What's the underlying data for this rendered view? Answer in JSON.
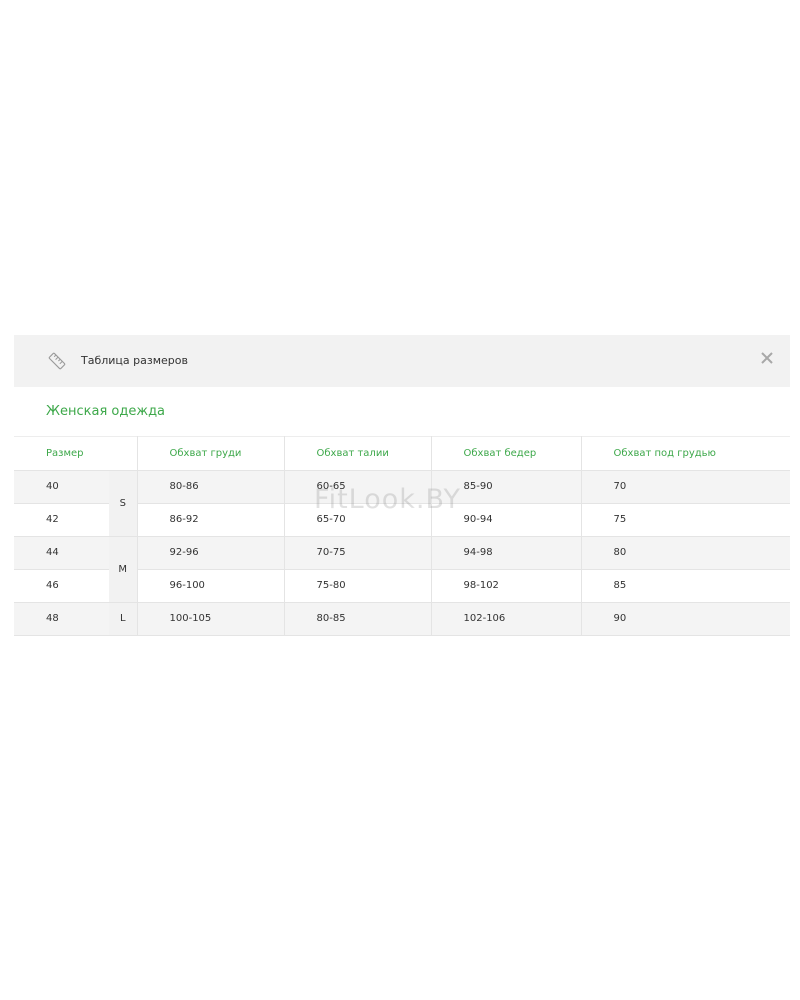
{
  "modal": {
    "title": "Таблица размеров",
    "icons": {
      "header": "ruler-icon",
      "close": "close-icon"
    }
  },
  "section": {
    "title": "Женская одежда"
  },
  "table": {
    "headers": [
      "Размер",
      "Обхват груди",
      "Обхват талии",
      "Обхват бедер",
      "Обхват под грудью"
    ],
    "rows": [
      {
        "size": "40",
        "chest": "80-86",
        "waist": "60-65",
        "hips": "85-90",
        "underbust": "70"
      },
      {
        "size": "42",
        "chest": "86-92",
        "waist": "65-70",
        "hips": "90-94",
        "underbust": "75"
      },
      {
        "size": "44",
        "chest": "92-96",
        "waist": "70-75",
        "hips": "94-98",
        "underbust": "80"
      },
      {
        "size": "46",
        "chest": "96-100",
        "waist": "75-80",
        "hips": "98-102",
        "underbust": "85"
      },
      {
        "size": "48",
        "chest": "100-105",
        "waist": "80-85",
        "hips": "102-106",
        "underbust": "90"
      }
    ],
    "letters": [
      "S",
      "M",
      "L"
    ]
  },
  "watermark": "FitLook.BY",
  "colors": {
    "accent": "#3da84a",
    "header_bg": "#f2f2f2",
    "row_alt": "#f4f4f4"
  }
}
